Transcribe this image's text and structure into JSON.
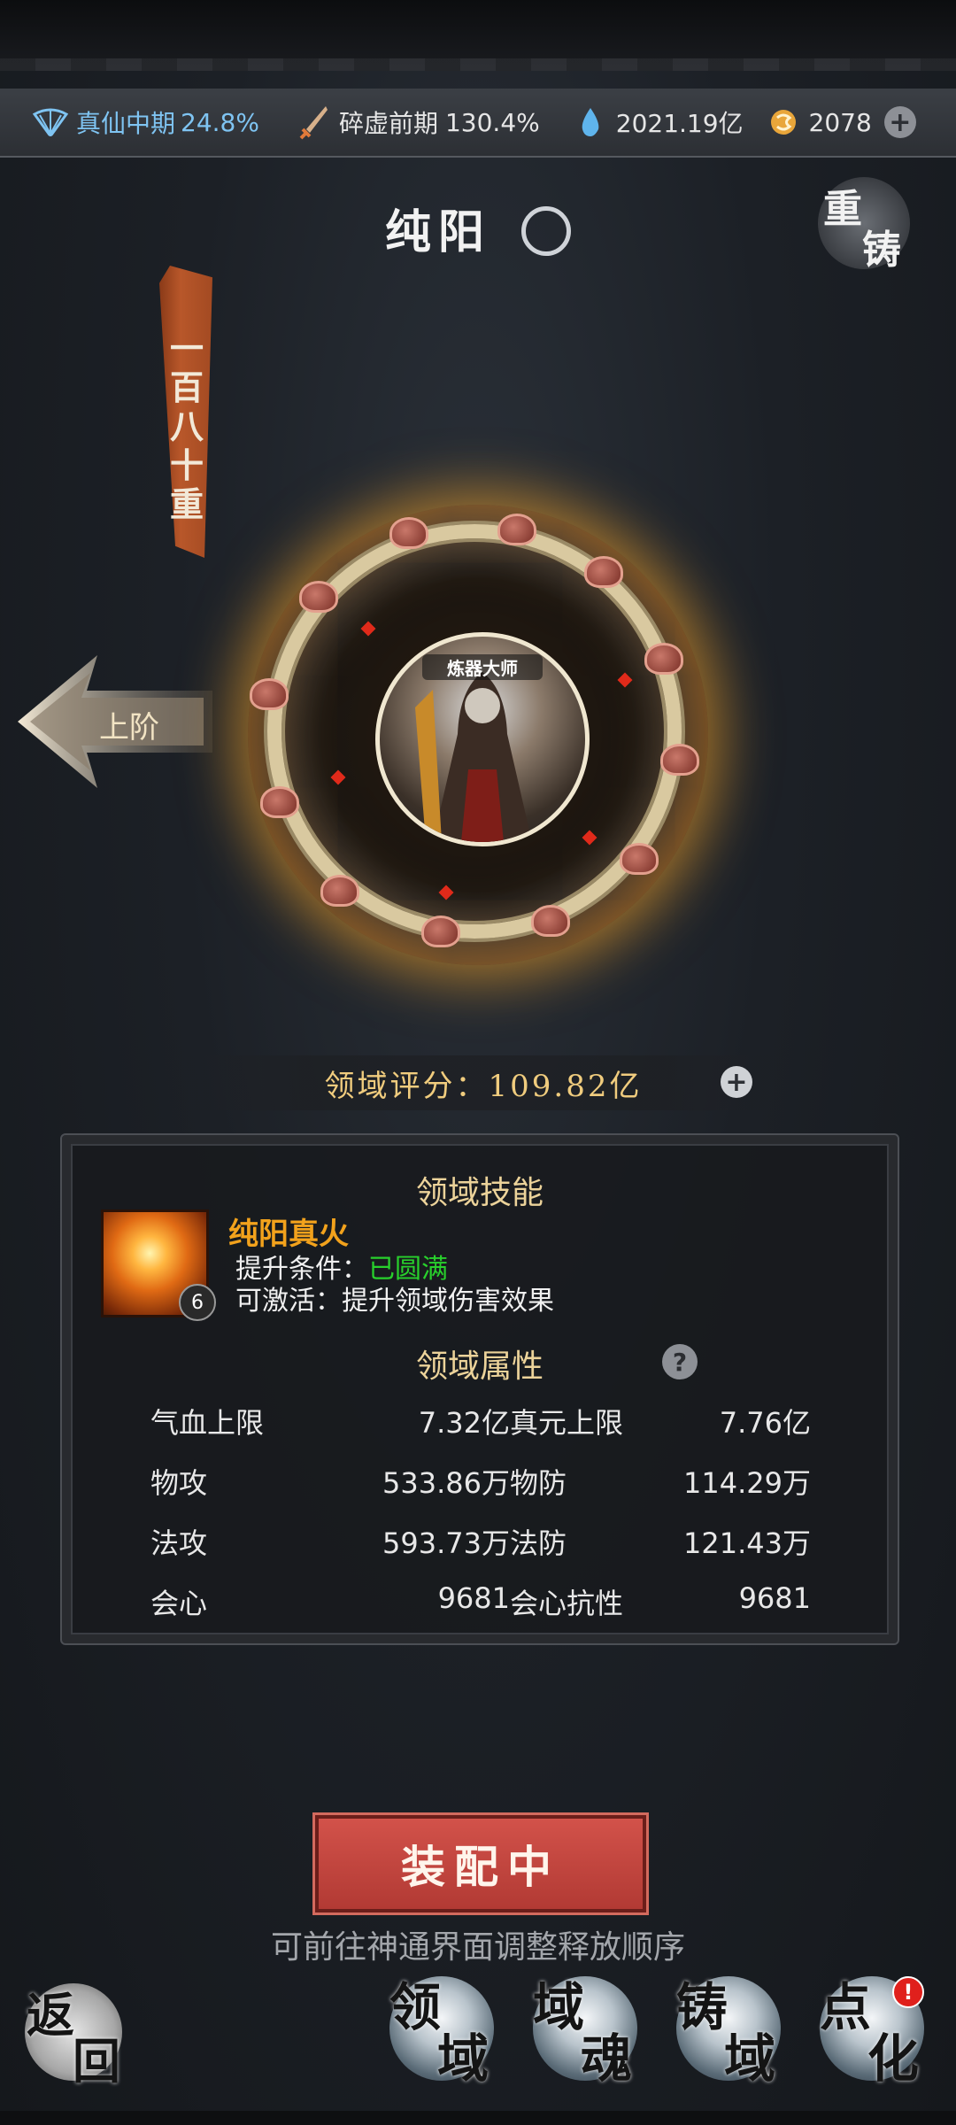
{
  "resources": {
    "realm": "真仙中期",
    "realm_pct": "24.8%",
    "body": "碎虚前期",
    "body_pct": "130.4%",
    "spirit_stones": "2021.19亿",
    "coins": "2078",
    "add_symbol": "+"
  },
  "domain": {
    "title": "纯阳",
    "tier_chars": [
      "一",
      "百",
      "八",
      "十",
      "重"
    ],
    "upper_stage_label": "上阶",
    "recast_chars": [
      "重",
      "铸"
    ],
    "portrait_tag": "炼器大师",
    "score": "领域评分：109.82亿"
  },
  "skill": {
    "section_title": "领域技能",
    "name": "纯阳真火",
    "level": "6",
    "condition_label": "提升条件：",
    "condition_value": "已圆满",
    "activate_text": "可激活：提升领域伤害效果"
  },
  "attributes": {
    "section_title": "领域属性",
    "help_symbol": "?",
    "rows": [
      {
        "l1": "气血上限",
        "v1": "7.32亿",
        "l2": "真元上限",
        "v2": "7.76亿"
      },
      {
        "l1": "物攻",
        "v1": "533.86万",
        "l2": "物防",
        "v2": "114.29万"
      },
      {
        "l1": "法攻",
        "v1": "593.73万",
        "l2": "法防",
        "v2": "121.43万"
      },
      {
        "l1": "会心",
        "v1": "9681",
        "l2": "会心抗性",
        "v2": "9681"
      }
    ]
  },
  "equip": {
    "label": "装配中",
    "hint": "可前往神通界面调整释放顺序"
  },
  "nav": {
    "back": [
      "返",
      "回"
    ],
    "items": [
      {
        "c1": "领",
        "c2": "域"
      },
      {
        "c1": "域",
        "c2": "魂"
      },
      {
        "c1": "铸",
        "c2": "域"
      },
      {
        "c1": "点",
        "c2": "化"
      }
    ],
    "badge": "!"
  },
  "colors": {
    "accent_gold": "#f0cc7e",
    "skill_orange": "#f2a21c",
    "complete_green": "#28d02c",
    "equip_red": "#c6463f"
  }
}
